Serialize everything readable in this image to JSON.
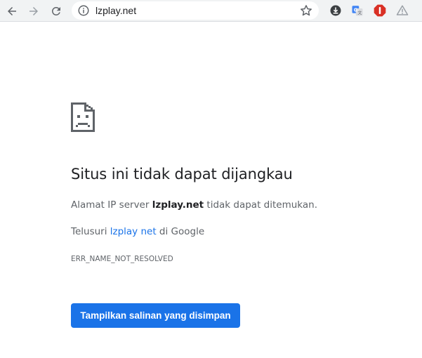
{
  "toolbar": {
    "back_icon": "arrow-left-icon",
    "forward_icon": "arrow-right-icon",
    "reload_icon": "reload-icon",
    "url": "lzplay.net",
    "info_icon": "info-icon",
    "star_icon": "star-outline-icon",
    "extensions": [
      {
        "name": "download-extension-icon",
        "color": "#3c4043"
      },
      {
        "name": "translate-extension-icon",
        "color": "#4285f4"
      },
      {
        "name": "adblock-extension-icon",
        "color": "#d93025"
      },
      {
        "name": "warning-extension-icon",
        "color": "#9aa0a6"
      }
    ]
  },
  "error": {
    "icon": "sad-page-icon",
    "title": "Situs ini tidak dapat dijangkau",
    "desc_prefix": "Alamat IP server ",
    "desc_host": "lzplay.net",
    "desc_suffix": " tidak dapat ditemukan.",
    "suggest_prefix": "Telusuri ",
    "suggest_link": "lzplay net",
    "suggest_suffix": " di Google",
    "code": "ERR_NAME_NOT_RESOLVED",
    "button_label": "Tampilkan salinan yang disimpan"
  },
  "colors": {
    "accent": "#1a73e8",
    "toolbar_bg": "#f1f3f4",
    "title": "#202124",
    "body_text": "#5f6368"
  }
}
